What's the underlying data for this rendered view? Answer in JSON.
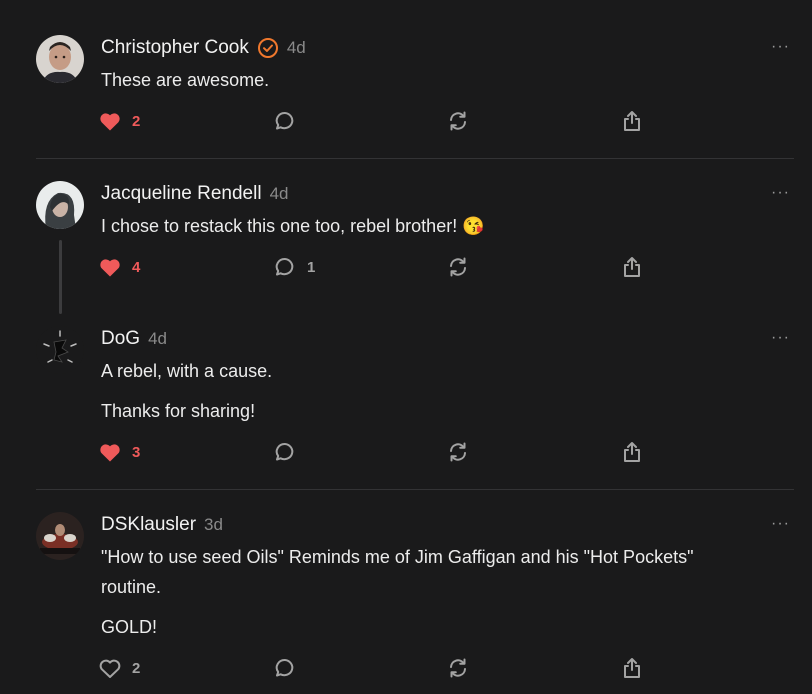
{
  "comments": [
    {
      "name": "Christopher Cook",
      "verified": true,
      "time": "4d",
      "lines": [
        "These are awesome."
      ],
      "likes": "2",
      "liked": true,
      "replies": ""
    },
    {
      "name": "Jacqueline Rendell",
      "verified": false,
      "time": "4d",
      "lines": [
        "I chose to restack this one too, rebel brother! 😘"
      ],
      "likes": "4",
      "liked": true,
      "replies": "1"
    },
    {
      "name": "DoG",
      "verified": false,
      "time": "4d",
      "lines": [
        "A rebel, with a cause.",
        "Thanks for sharing!"
      ],
      "likes": "3",
      "liked": true,
      "replies": ""
    },
    {
      "name": "DSKlausler",
      "verified": false,
      "time": "3d",
      "lines": [
        "\"How to use seed Oils\" Reminds me of Jim Gaffigan and his \"Hot Pockets\"",
        "routine.",
        "GOLD!"
      ],
      "likes": "2",
      "liked": false,
      "replies": ""
    }
  ],
  "more_label": "···",
  "colors": {
    "accent_like": "#ef5a5a",
    "verified": "#f0782d",
    "background": "#1a1a1b"
  },
  "icons": [
    "heart-icon",
    "comment-icon",
    "restack-icon",
    "share-icon",
    "verified-check-icon",
    "more-options-icon"
  ]
}
